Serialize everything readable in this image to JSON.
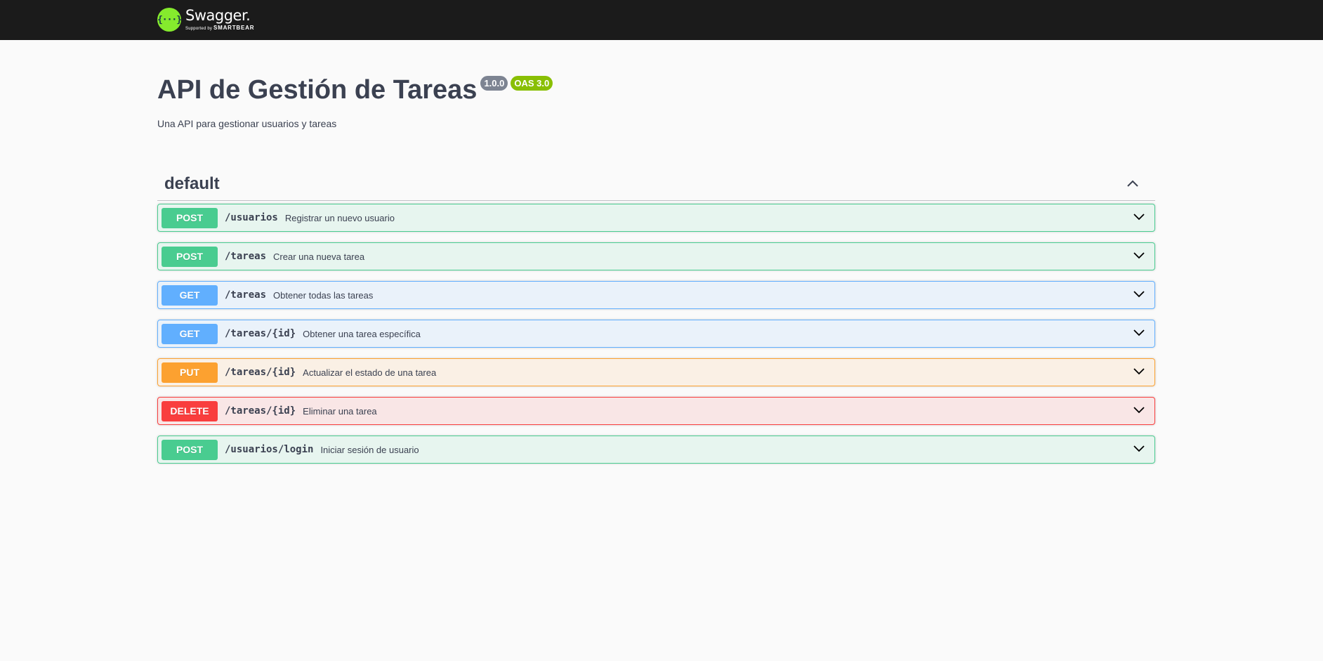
{
  "topbar": {
    "logo_symbol": "{···}",
    "logo_name": "Swagger.",
    "logo_supported": "Supported by",
    "logo_company": "SMARTBEAR",
    "logo_icon": "swagger-logo-icon"
  },
  "info": {
    "title": "API de Gestión de Tareas",
    "version": "1.0.0",
    "oas": "OAS 3.0",
    "description": "Una API para gestionar usuarios y tareas"
  },
  "tag": {
    "name": "default",
    "toggle_icon": "chevron-up-icon"
  },
  "colors": {
    "post": "#49cc90",
    "get": "#61affe",
    "put": "#fca130",
    "delete": "#f93e3e"
  },
  "operations": [
    {
      "method": "POST",
      "path": "/usuarios",
      "summary": "Registrar un nuevo usuario"
    },
    {
      "method": "POST",
      "path": "/tareas",
      "summary": "Crear una nueva tarea"
    },
    {
      "method": "GET",
      "path": "/tareas",
      "summary": "Obtener todas las tareas"
    },
    {
      "method": "GET",
      "path": "/tareas/{id}",
      "summary": "Obtener una tarea específica"
    },
    {
      "method": "PUT",
      "path": "/tareas/{id}",
      "summary": "Actualizar el estado de una tarea"
    },
    {
      "method": "DELETE",
      "path": "/tareas/{id}",
      "summary": "Eliminar una tarea"
    },
    {
      "method": "POST",
      "path": "/usuarios/login",
      "summary": "Iniciar sesión de usuario"
    }
  ]
}
